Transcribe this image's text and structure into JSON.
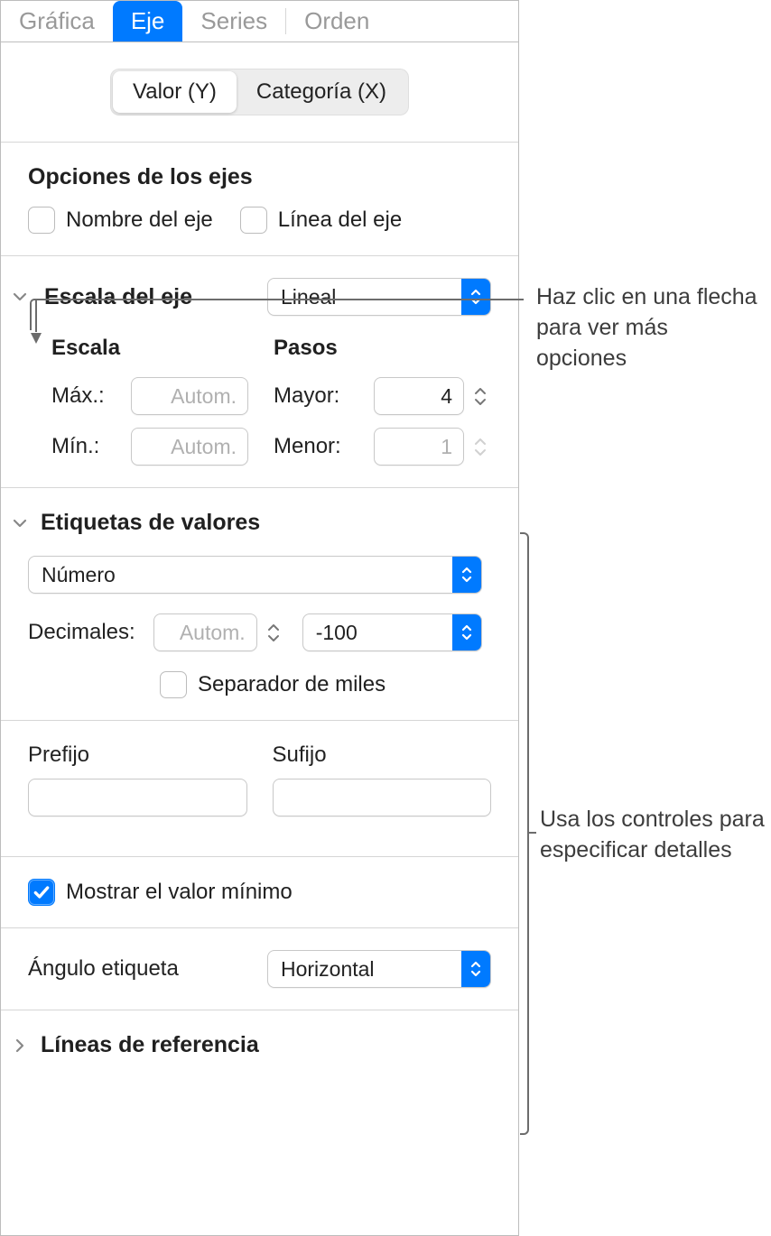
{
  "tabs": {
    "chart": "Gráfica",
    "axis": "Eje",
    "series": "Series",
    "order": "Orden"
  },
  "segmented": {
    "valueY": "Valor (Y)",
    "categoryX": "Categoría (X)"
  },
  "axisOptions": {
    "title": "Opciones de los ejes",
    "axisName": "Nombre del eje",
    "axisLine": "Línea del eje"
  },
  "axisScale": {
    "title": "Escala del eje",
    "type": "Lineal",
    "scale": {
      "label": "Escala",
      "maxLabel": "Máx.:",
      "maxPlaceholder": "Autom.",
      "minLabel": "Mín.:",
      "minPlaceholder": "Autom."
    },
    "steps": {
      "label": "Pasos",
      "majorLabel": "Mayor:",
      "majorValue": "4",
      "minorLabel": "Menor:",
      "minorValue": "1"
    }
  },
  "valueLabels": {
    "title": "Etiquetas de valores",
    "format": "Número",
    "decimalsLabel": "Decimales:",
    "decimalsPlaceholder": "Autom.",
    "negativeFormat": "-100",
    "thousandsSep": "Separador de miles",
    "prefixLabel": "Prefijo",
    "suffixLabel": "Sufijo",
    "showMinValue": "Mostrar el valor mínimo",
    "labelAngleLabel": "Ángulo etiqueta",
    "labelAngleValue": "Horizontal"
  },
  "refLines": {
    "title": "Líneas de referencia"
  },
  "callouts": {
    "arrow": "Haz clic en una flecha para ver más opciones",
    "controls": "Usa los controles para especificar detalles"
  }
}
